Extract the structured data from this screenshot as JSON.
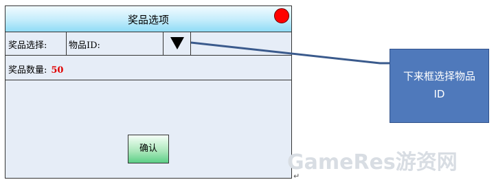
{
  "dialog": {
    "title": "奖品选项",
    "prize_select_label": "奖品选择:",
    "item_id_label": "物品ID:",
    "quantity_label": "奖品数量:",
    "quantity_value": "50",
    "confirm_label": "确认"
  },
  "callout": {
    "text": "下来框选择物品 ID"
  },
  "watermark": {
    "text": "GameRes游资网"
  },
  "colors": {
    "title_gradient_bottom": "#8fdcf6",
    "close_dot": "#ff0000",
    "dialog_bg": "#e6edf7",
    "quantity_value": "#e00000",
    "confirm_gradient_bottom": "#5ccf86",
    "callout_bg": "#4f79bb",
    "connector": "#3a5a8c"
  },
  "icons": {
    "close": "red-circle-icon",
    "dropdown": "triangle-down-icon"
  }
}
